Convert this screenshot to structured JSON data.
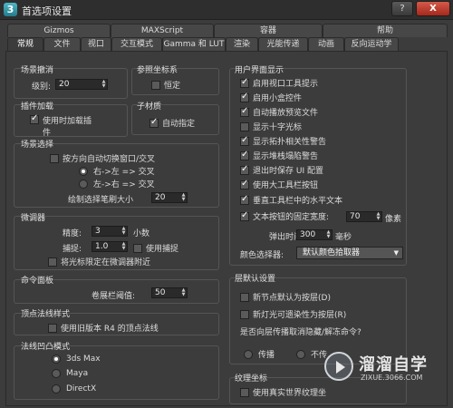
{
  "window": {
    "title": "首选项设置",
    "help_label": "?",
    "close_label": "X"
  },
  "tabs_top": [
    "Gizmos",
    "MAXScript",
    "容器",
    "帮助"
  ],
  "tabs_bottom": [
    "常规",
    "文件",
    "视口",
    "交互模式",
    "Gamma 和 LUT",
    "渲染",
    "光能传递",
    "动画",
    "反向运动学"
  ],
  "scene_undo": {
    "title": "场景撤消",
    "level_label": "级别:",
    "level_value": "20"
  },
  "ref_coord": {
    "title": "参照坐标系",
    "constant_label": "恒定"
  },
  "plugin_load": {
    "title": "插件加载",
    "load_on_demand_label": "使用时加载插件"
  },
  "sub_material": {
    "title": "子材质",
    "auto_assign_label": "自动指定"
  },
  "scene_selection": {
    "title": "场景选择",
    "auto_window_label": "按方向自动切换窗口/交叉",
    "rtl_cross_label": "右->左 => 交叉",
    "ltr_cross_label": "左->右 => 交叉",
    "brush_size_label": "绘制选择笔刷大小",
    "brush_size_value": "20"
  },
  "spinners": {
    "title": "微调器",
    "precision_label": "精度:",
    "precision_value": "3",
    "decimals_label": "小数",
    "snap_label": "捕捉:",
    "snap_value": "1.0",
    "use_snap_label": "使用捕捉",
    "wrap_cursor_label": "将光标限定在微调器附近"
  },
  "command_panel": {
    "title": "命令面板",
    "rollup_threshold_label": "卷展栏阈值:",
    "rollup_threshold_value": "50"
  },
  "vertex_normal": {
    "title": "顶点法线样式",
    "legacy_r4_label": "使用旧版本 R4 的顶点法线"
  },
  "bump_mode": {
    "title": "法线凹凸模式",
    "options": [
      "3ds Max",
      "Maya",
      "DirectX"
    ]
  },
  "ui_display": {
    "title": "用户界面显示",
    "items": [
      "启用视口工具提示",
      "启用小盒控件",
      "自动播放预览文件",
      "显示十字光标",
      "显示拓扑相关性警告",
      "显示堆栈塌陷警告",
      "退出时保存 UI 配置",
      "使用大工具栏按钮",
      "垂直工具栏中的水平文本",
      "文本按钮的固定宽度:"
    ],
    "text_width_value": "70",
    "text_width_unit": "像素",
    "flyout_time_label": "弹出时间:",
    "flyout_time_value": "300",
    "flyout_time_unit": "毫秒",
    "color_selector_label": "颜色选择器:",
    "color_selector_value": "默认颜色拾取器"
  },
  "layer_defaults": {
    "title": "层默认设置",
    "new_nodes_label": "新节点默认为按层(D)",
    "new_lights_label": "新灯光可遗染性为按层(R)",
    "question_label": "是否向层传播取消隐藏/解冻命令?",
    "propagate_label": "传播",
    "not_propagate_label": "不传"
  },
  "texture_coords": {
    "title": "纹理坐标",
    "real_world_label": "使用真实世界纹理坐"
  },
  "watermark": {
    "brand": "溜溜自学",
    "url": "ZIXUE.3066.COM"
  }
}
